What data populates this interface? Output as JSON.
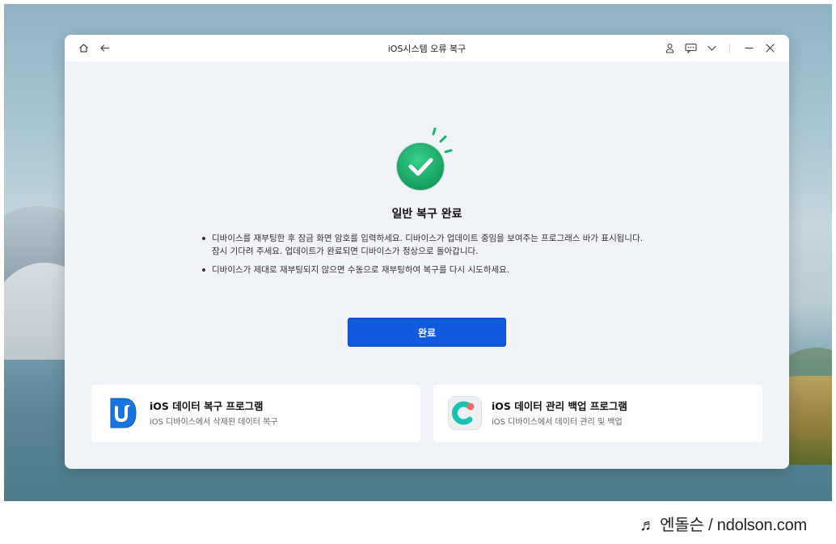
{
  "window": {
    "title": "iOS시스템 오류 복구"
  },
  "titlebar_icons": {
    "left": [
      "home-icon",
      "back-arrow-icon"
    ],
    "right": [
      "account-icon",
      "feedback-icon",
      "menu-dropdown-icon",
      "minimize-icon",
      "close-icon"
    ]
  },
  "result": {
    "title": "일반 복구 완료",
    "instructions": [
      "디바이스를 재부팅한 후 잠금 화면 암호를 입력하세요. 디바이스가 업데이트 중임을 보여주는 프로그래스 바가  표시됩니다. 잠시 기다려 주세요. 업데이트가 완료되면 디바이스가 정상으로 돌아갑니다.",
      "디바이스가 제대로 재부팅되지 않으면 수동으로 재부팅하여 복구를 다시 시도하세요."
    ],
    "done_button": "완료"
  },
  "promos": [
    {
      "title": "iOS 데이터 복구 프로그램",
      "description": "iOS 디바이스에서 삭제된 데이터 복구",
      "icon": "data-recovery-app-icon"
    },
    {
      "title": "iOS 데이터 관리 백업 프로그램",
      "description": "iOS 디바이스에서 데이터 관리 및 백업",
      "icon": "data-backup-app-icon"
    }
  ],
  "watermark": {
    "text": "♬ 엔돌슨 / ndolson.com"
  },
  "colors": {
    "accent_blue": "#0f5adf",
    "success_green": "#1db56e",
    "window_bg": "#f0f3f7"
  }
}
